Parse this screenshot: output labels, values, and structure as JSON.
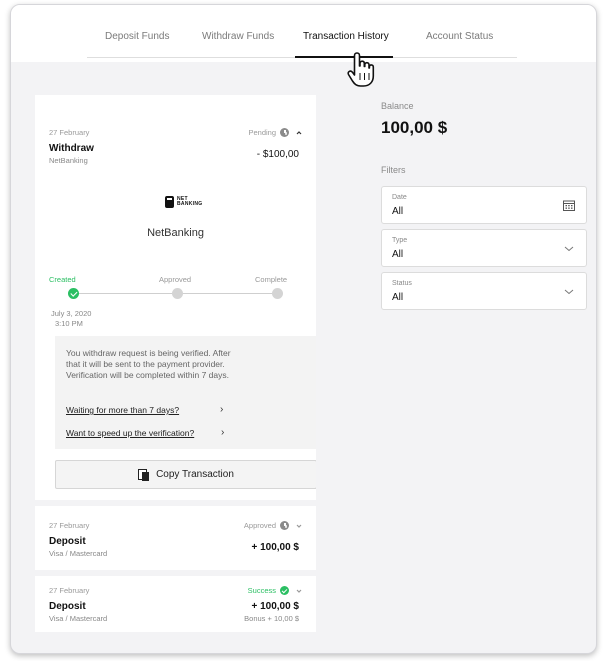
{
  "tabs": [
    {
      "label": "Deposit Funds"
    },
    {
      "label": "Withdraw Funds"
    },
    {
      "label": "Transaction History",
      "active": true
    },
    {
      "label": "Account Status"
    }
  ],
  "balance": {
    "label": "Balance",
    "value": "100,00 $"
  },
  "filters": {
    "label": "Filters",
    "date": {
      "label": "Date",
      "value": "All",
      "icon": "calendar-icon"
    },
    "type": {
      "label": "Type",
      "value": "All",
      "icon": "chevron-down-icon"
    },
    "status": {
      "label": "Status",
      "value": "All",
      "icon": "chevron-down-icon"
    }
  },
  "transactions": [
    {
      "date": "27 February",
      "status": "Pending",
      "status_icon": "clock-icon",
      "title": "Withdraw",
      "method": "NetBanking",
      "amount": "- $100,00",
      "expanded": true,
      "provider_logo_text": [
        "NET",
        "BANKING"
      ],
      "provider_name": "NetBanking",
      "steps": [
        {
          "label": "Created",
          "done": true
        },
        {
          "label": "Approved",
          "done": false
        },
        {
          "label": "Complete",
          "done": false
        }
      ],
      "created_date": "July 3, 2020",
      "created_time": "3:10 PM",
      "info_text": "You withdraw request is being verified. After that it will be sent to the payment provider. Verification will be completed within 7 days.",
      "links": [
        "Waiting for more than 7 days?",
        "Want to speed up the verification?"
      ],
      "copy_label": "Copy Transaction"
    },
    {
      "date": "27 February",
      "status": "Approved",
      "status_icon": "clock-icon",
      "title": "Deposit",
      "method": "Visa / Mastercard",
      "amount": "+ 100,00 $",
      "expanded": false
    },
    {
      "date": "27 February",
      "status": "Success",
      "status_icon": "check-circle-icon",
      "status_color": "#2bbf63",
      "title": "Deposit",
      "method": "Visa / Mastercard",
      "amount": "+ 100,00 $",
      "bonus": "Bonus + 10,00 $",
      "expanded": false
    }
  ],
  "colors": {
    "success": "#2bbf63",
    "muted": "#9a9a9a",
    "frame": "#f3f3f5"
  }
}
